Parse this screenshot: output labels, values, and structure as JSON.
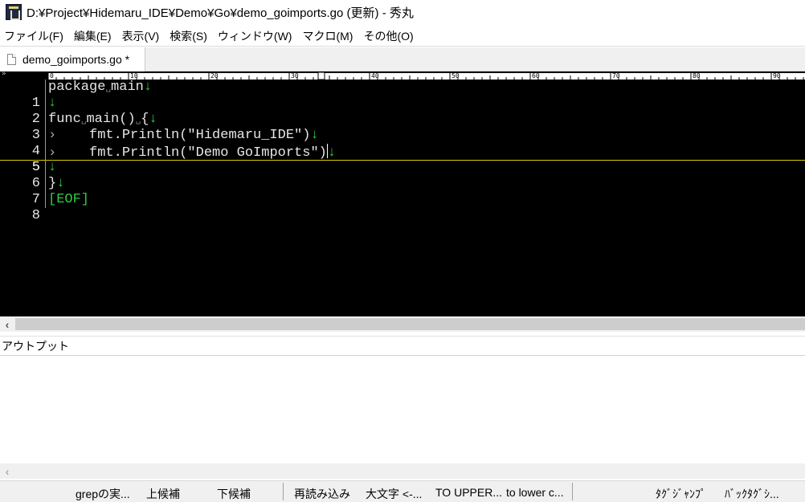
{
  "window": {
    "title": "D:¥Project¥Hidemaru_IDE¥Demo¥Go¥demo_goimports.go (更新) - 秀丸",
    "app_icon": "hidemaru-app-icon"
  },
  "menu": [
    "ファイル(F)",
    "編集(E)",
    "表示(V)",
    "検索(S)",
    "ウィンドウ(W)",
    "マクロ(M)",
    "その他(O)"
  ],
  "tab": {
    "label": "demo_goimports.go *",
    "icon": "document-icon"
  },
  "ruler": {
    "marker": "»",
    "labels": [
      "0",
      "10",
      "20",
      "30",
      "40",
      "50",
      "60",
      "70",
      "80",
      "90"
    ],
    "cursor_column": 34
  },
  "editor": {
    "current_line": 5,
    "line_numbers": [
      "1",
      "2",
      "3",
      "4",
      "5",
      "6",
      "7",
      "8"
    ],
    "newline_mark": "↓",
    "space_mark": "␣",
    "tab_mark": "›",
    "eof_mark": "[EOF]",
    "lines": [
      {
        "parts": [
          "package",
          "main"
        ]
      },
      {
        "parts": []
      },
      {
        "parts": [
          "func",
          "main()",
          "{"
        ]
      },
      {
        "indent": "    fmt.Println(\"Hidemaru_IDE\")"
      },
      {
        "indent": "    fmt.Println(\"Demo GoImports\")"
      },
      {
        "parts": []
      },
      {
        "text": "}"
      },
      {
        "eof": true
      }
    ]
  },
  "output": {
    "title": "アウトプット"
  },
  "statusbar": {
    "keys": [
      "grepの実...",
      "上候補",
      "下候補",
      "再読み込み",
      "大文字 <-...",
      "TO UPPER...",
      "to lower c...",
      "ﾀｸﾞｼﾞｬﾝﾌﾟ",
      "ﾊﾞｯｸﾀｸﾞｼ..."
    ]
  },
  "colors": {
    "editor_bg": "#000000",
    "text": "#e6e6e6",
    "mark_green": "#2ecc40",
    "cursor_line": "#d8c800"
  }
}
